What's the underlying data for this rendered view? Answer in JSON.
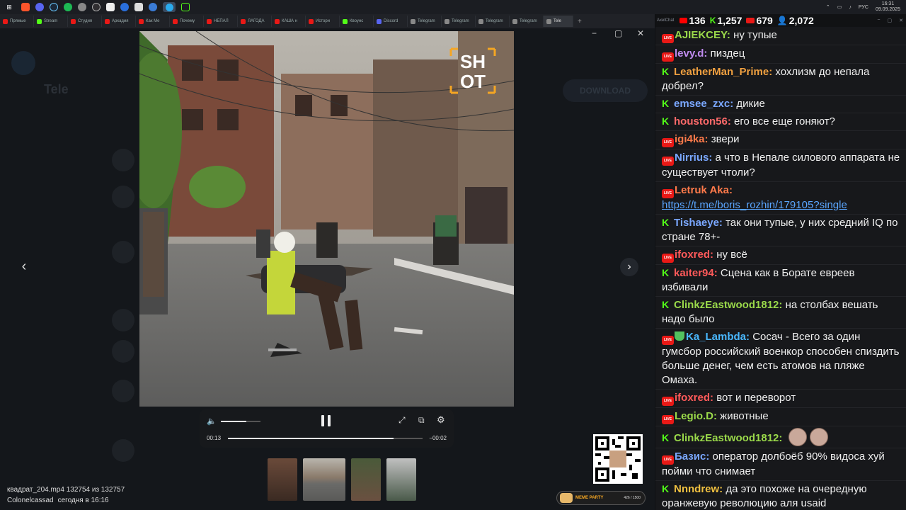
{
  "taskbar": {
    "apps": [
      "windows-logo",
      "brave-browser",
      "discord",
      "steam",
      "spotify",
      "chrome",
      "obs",
      "epic",
      "app-b",
      "app-c",
      "app-d",
      "telegram",
      "app-e"
    ],
    "tray": {
      "lang": "РУС",
      "time": "16:31",
      "date": "09.09.2025"
    }
  },
  "browser_tabs": [
    {
      "label": "Прямые",
      "color": "#e91916"
    },
    {
      "label": "Stream",
      "color": "#53fc18"
    },
    {
      "label": "Студия",
      "color": "#e91916"
    },
    {
      "label": "Аркадия",
      "color": "#e91916"
    },
    {
      "label": "Как Me",
      "color": "#e91916"
    },
    {
      "label": "Почему",
      "color": "#e91916"
    },
    {
      "label": "НЕПАЛ",
      "color": "#e91916"
    },
    {
      "label": "ЛАГОДА",
      "color": "#e91916"
    },
    {
      "label": "КАША н",
      "color": "#e91916"
    },
    {
      "label": "Истори",
      "color": "#e91916"
    },
    {
      "label": "Квоунс",
      "color": "#53fc18"
    },
    {
      "label": "Discord",
      "color": "#5865f2"
    },
    {
      "label": "Telegram",
      "color": "#888"
    },
    {
      "label": "Telegram",
      "color": "#888"
    },
    {
      "label": "Telegram",
      "color": "#888"
    },
    {
      "label": "Telegram",
      "color": "#888"
    },
    {
      "label": "Tele",
      "color": "#888",
      "active": true
    }
  ],
  "telegram": {
    "title": "Tele",
    "download_label": "DOWNLOAD"
  },
  "viewer": {
    "watermark": "SHOT",
    "elapsed": "00:13",
    "remaining": "−00:02",
    "progress": 0.85,
    "volume": 0.65,
    "file_name": "квадрат_204.mp4 132754 из 132757",
    "author": "Colonelcassad",
    "posted": "сегодня в 16:16"
  },
  "overlay": {
    "meme_label": "MEME PARTY",
    "meme_count": "426 / 1500"
  },
  "chat": {
    "app_label": "AxelChat",
    "stats": {
      "youtube": "136",
      "kick": "1,257",
      "twitch": "679",
      "viewers": "2,072"
    },
    "messages": [
      {
        "platform": "live",
        "user": "AJIEKCEY:",
        "color": "#9ad94a",
        "text": "ну тупые"
      },
      {
        "platform": "live",
        "user": "levy.d:",
        "color": "#c08cf0",
        "text": "пиздец"
      },
      {
        "platform": "kick",
        "user": "LeatherMan_Prime:",
        "color": "#f0a040",
        "text": "хохлизм до непала добрел?"
      },
      {
        "platform": "kick",
        "user": "emsee_zxc:",
        "color": "#7aa7ff",
        "text": "дикие"
      },
      {
        "platform": "kick",
        "user": "houston56:",
        "color": "#ff6a6a",
        "text": "его все еще гоняют?"
      },
      {
        "platform": "live",
        "user": "igi4ka:",
        "color": "#ff7a4a",
        "text": "звери"
      },
      {
        "platform": "live",
        "user": "Nirrius:",
        "color": "#7aa7ff",
        "text": "а что в Непале силового аппарата не существует чтоли?"
      },
      {
        "platform": "live",
        "user": "Letruk Aka:",
        "color": "#ff7a4a",
        "text": "",
        "link": "https://t.me/boris_rozhin/179105?single"
      },
      {
        "platform": "kick",
        "user": "Tishaeye:",
        "color": "#7aa7ff",
        "text": "так они тупые, у них средний IQ по стране 78+-"
      },
      {
        "platform": "live",
        "user": "ifoxred:",
        "color": "#ff5a5a",
        "text": "ну всё"
      },
      {
        "platform": "kick",
        "user": "kaiter94:",
        "color": "#ff5a5a",
        "text": "Сцена как в Борате евреев избивали"
      },
      {
        "platform": "kick",
        "user": "ClinkzEastwood1812:",
        "color": "#9ad94a",
        "text": "на столбах вешать надо было"
      },
      {
        "platform": "live",
        "user": "Ka_Lambda:",
        "color": "#4ab8ff",
        "text": "Сосач - Всего за один гумсбор российский военкор способен спиздить больше денег, чем есть атомов на пляже Омаха.",
        "shield": true
      },
      {
        "platform": "live",
        "user": "ifoxred:",
        "color": "#ff5a5a",
        "text": "вот и переворот"
      },
      {
        "platform": "live",
        "user": "Legio.D:",
        "color": "#9ad94a",
        "text": "животные"
      },
      {
        "platform": "kick",
        "user": "ClinkzEastwood1812:",
        "color": "#9ad94a",
        "text": "",
        "emotes": 2
      },
      {
        "platform": "live",
        "user": "Базис:",
        "color": "#7aa7ff",
        "text": "оператор долбоёб 90% видоса хуй пойми что снимает"
      },
      {
        "platform": "kick",
        "user": "Nnndrew:",
        "color": "#f0c040",
        "text": "да это похоже на очередную оранжевую революцию аля usaid"
      }
    ]
  }
}
